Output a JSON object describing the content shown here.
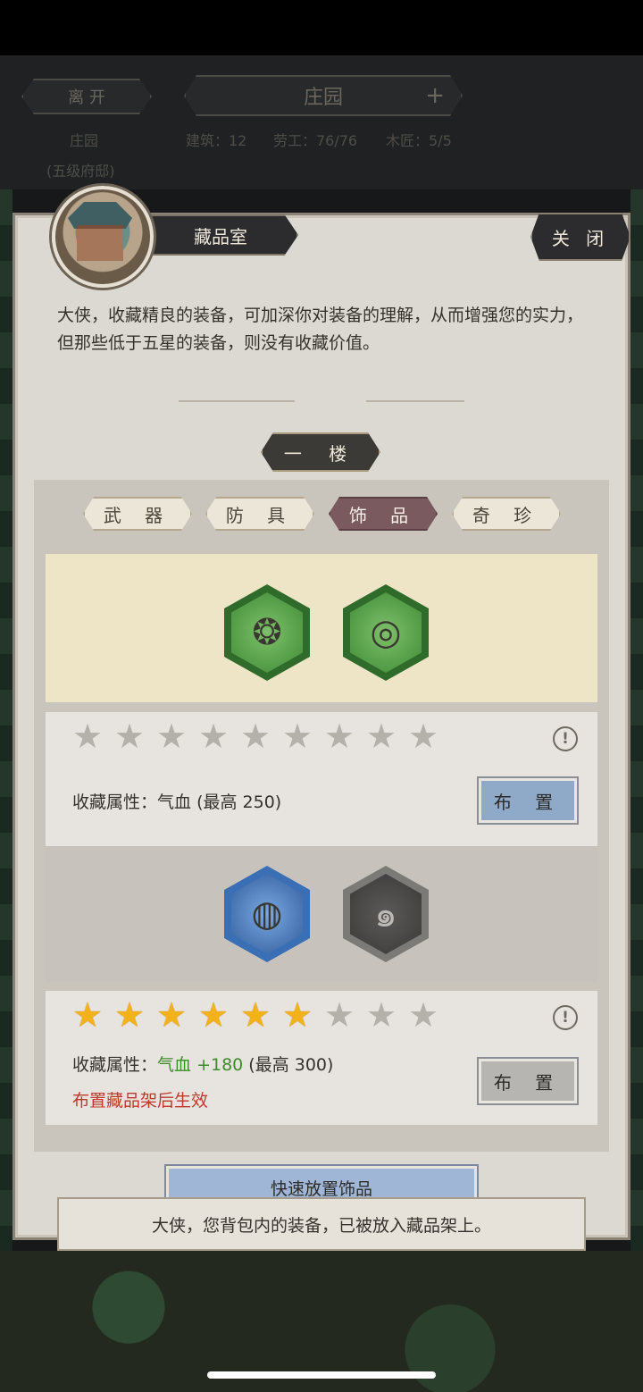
{
  "hud": {
    "leave_label": "离 开",
    "estate_title": "庄园",
    "add_symbol": "+",
    "location": "庄园",
    "location_sub": "(五级府邸)",
    "stats": [
      "建筑：12",
      "劳工：76/76",
      "木匠：5/5"
    ]
  },
  "panel": {
    "title": "藏品室",
    "close_label": "关 闭",
    "intro": "大侠，收藏精良的装备，可加深你对装备的理解，从而增强您的实力，但那些低于五星的装备，则没有收藏价值。",
    "floor_tab": "一 楼",
    "category_tabs": [
      {
        "label": "武 器",
        "active": false
      },
      {
        "label": "防 具",
        "active": false
      },
      {
        "label": "饰 品",
        "active": true
      },
      {
        "label": "奇 珍",
        "active": false
      }
    ]
  },
  "shelves": [
    {
      "items": [
        {
          "icon": "jade-pendant-icon",
          "frame": "green"
        },
        {
          "icon": "jade-ring-pendant-icon",
          "frame": "green"
        }
      ],
      "stars_total": 9,
      "stars_filled": 0,
      "attr_label": "收藏属性：",
      "attr_value": "气血",
      "attr_bonus": "",
      "attr_max": "(最高 250)",
      "note": "",
      "button_label": "布 置",
      "button_style": "blue"
    },
    {
      "items": [
        {
          "icon": "blue-bracelet-icon",
          "frame": "blue"
        },
        {
          "icon": "dragon-amulet-icon",
          "frame": "grey"
        }
      ],
      "stars_total": 9,
      "stars_filled": 6,
      "attr_label": "收藏属性：",
      "attr_value": "气血",
      "attr_bonus": " +180",
      "attr_max": " (最高 300)",
      "note": "布置藏品架后生效",
      "button_label": "布 置",
      "button_style": "grey"
    }
  ],
  "quick_place_label": "快速放置饰品",
  "toast": "大侠，您背包内的装备，已被放入藏品架上。",
  "colors": {
    "star_on": "#f3b21a",
    "star_off": "#b4b0aa",
    "bonus_green": "#3e8c2a",
    "note_red": "#c0392b",
    "button_blue": "#8fa9c8"
  }
}
